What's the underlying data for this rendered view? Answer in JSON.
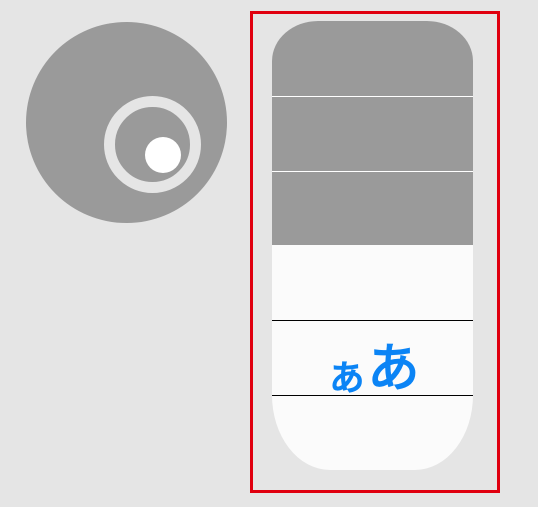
{
  "icons": {
    "disc": "disc-icon"
  },
  "selection": {
    "color": "#e0000f"
  },
  "pill": {
    "top_color": "#9a9a9a",
    "bottom_color": "#fbfbfb",
    "kana_small": "ぁ",
    "kana_large": "あ",
    "kana_color": "#0b84f5"
  }
}
